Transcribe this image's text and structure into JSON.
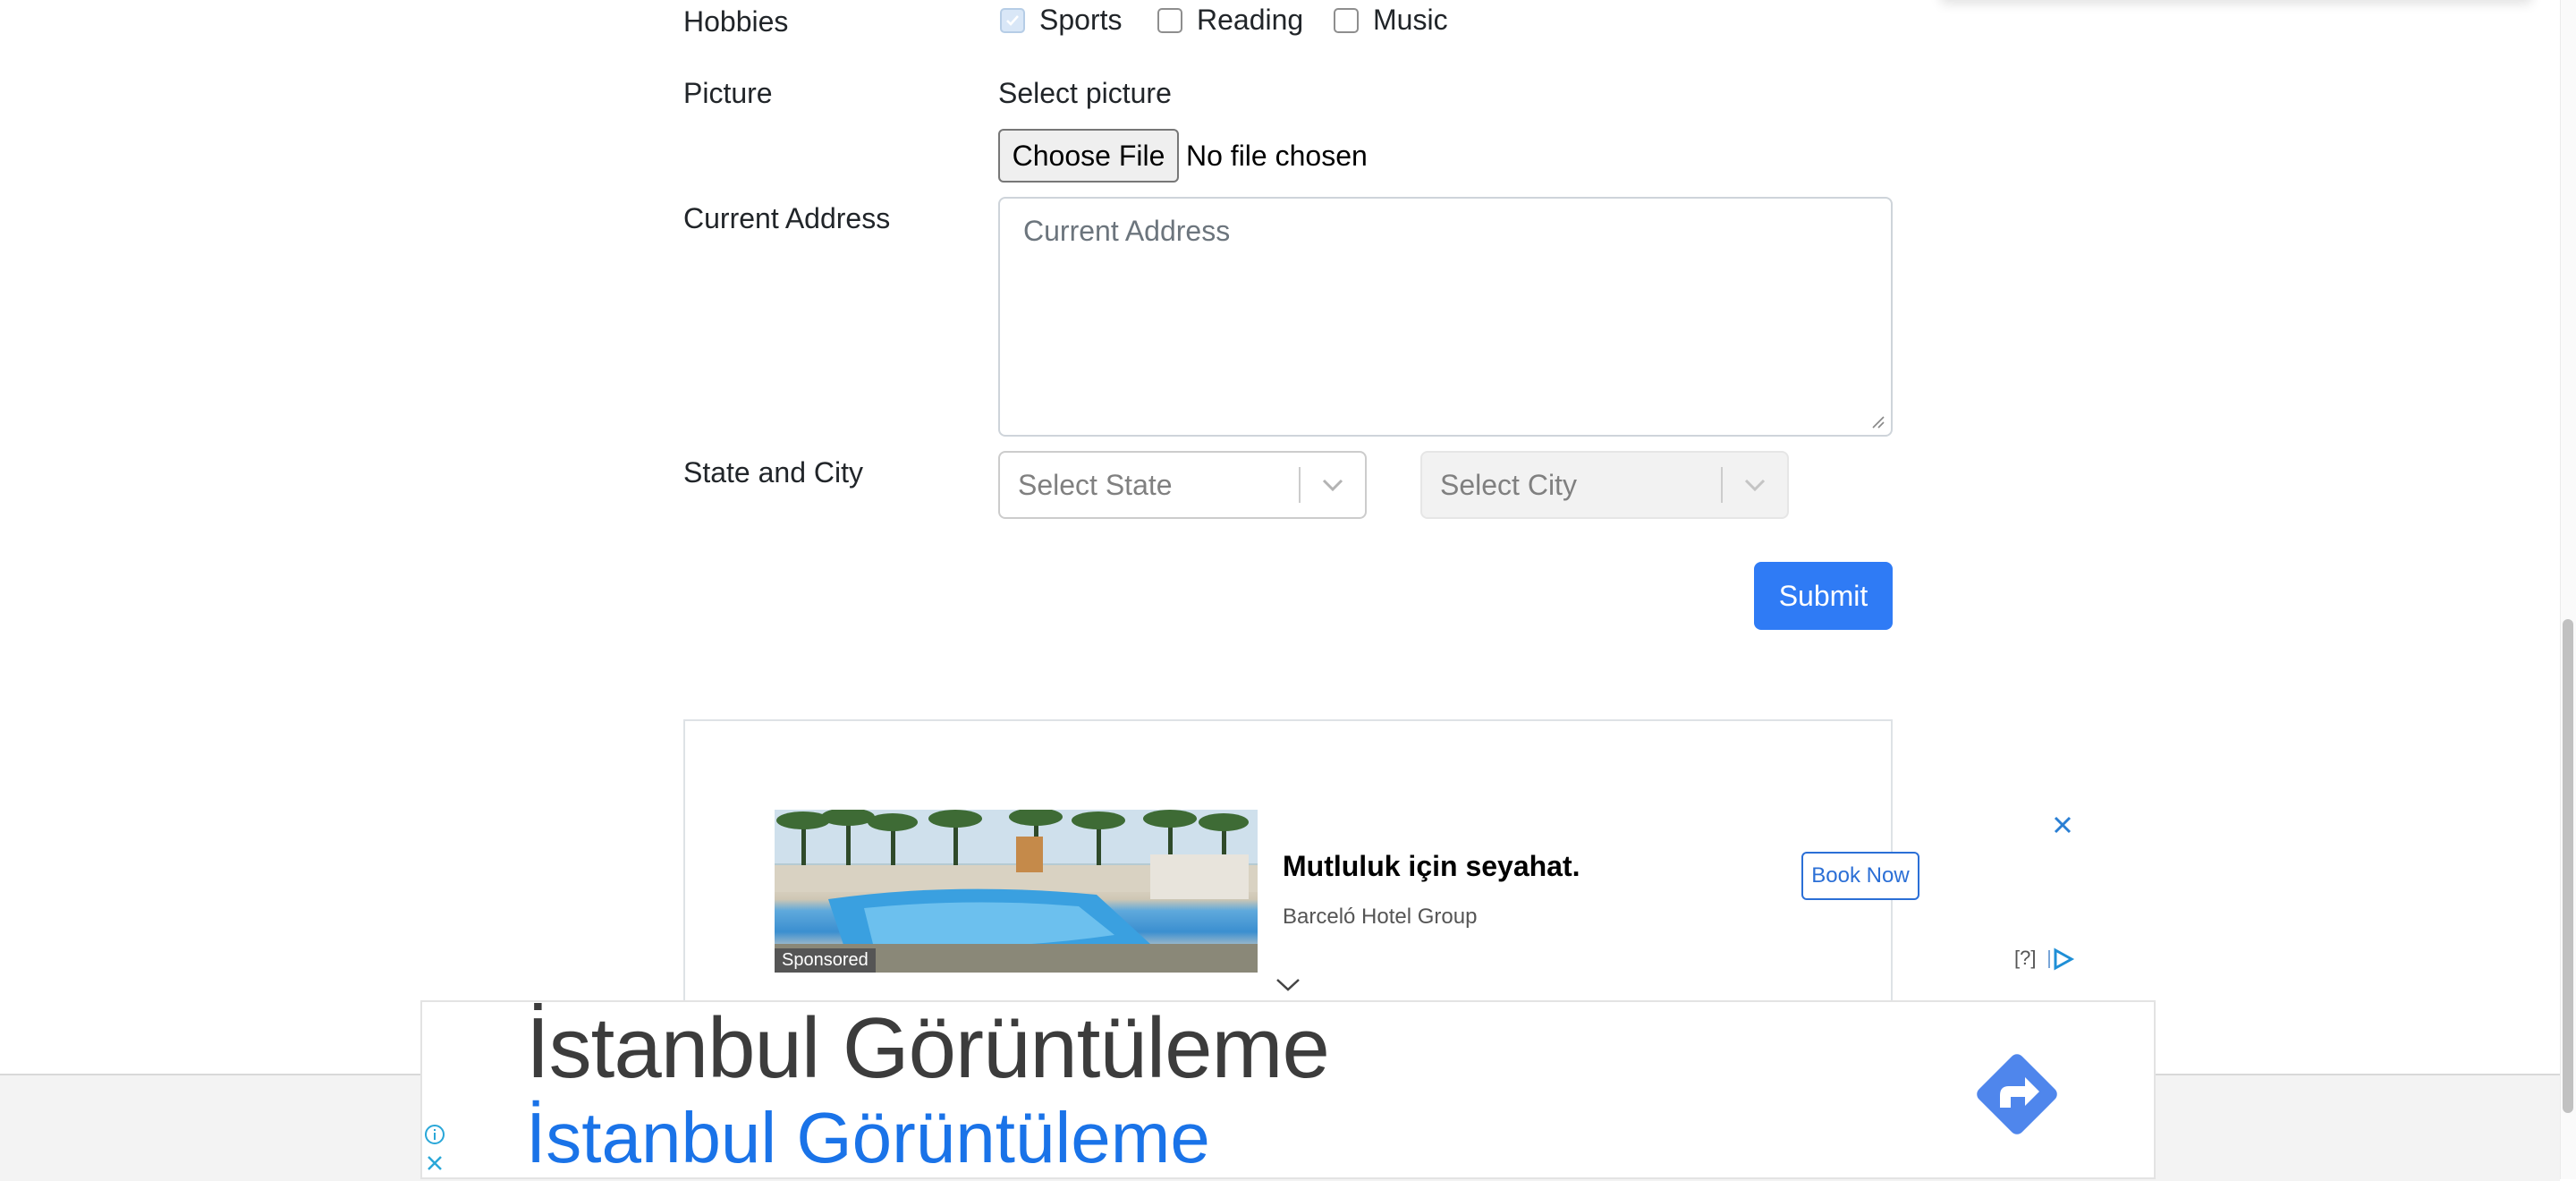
{
  "form": {
    "hobbies": {
      "label": "Hobbies",
      "options": [
        {
          "label": "Sports",
          "checked": true
        },
        {
          "label": "Reading",
          "checked": false
        },
        {
          "label": "Music",
          "checked": false
        }
      ]
    },
    "picture": {
      "label": "Picture",
      "select_label": "Select picture",
      "button_label": "Choose File",
      "status_text": "No file chosen"
    },
    "address": {
      "label": "Current Address",
      "placeholder": "Current Address"
    },
    "state_city": {
      "label": "State and City",
      "state_placeholder": "Select State",
      "city_placeholder": "Select City"
    },
    "submit_label": "Submit"
  },
  "ad": {
    "sponsored_label": "Sponsored",
    "title": "Mutluluk için seyahat.",
    "advertiser": "Barceló Hotel Group",
    "cta_label": "Book Now",
    "help_label": "[?]"
  },
  "banner": {
    "line1": "İstanbul Görüntüleme",
    "line2": "İstanbul Görüntüleme"
  },
  "colors": {
    "primary": "#2f7bf5",
    "link_blue": "#1a73e8",
    "text": "#212529",
    "placeholder": "#6c757d"
  }
}
